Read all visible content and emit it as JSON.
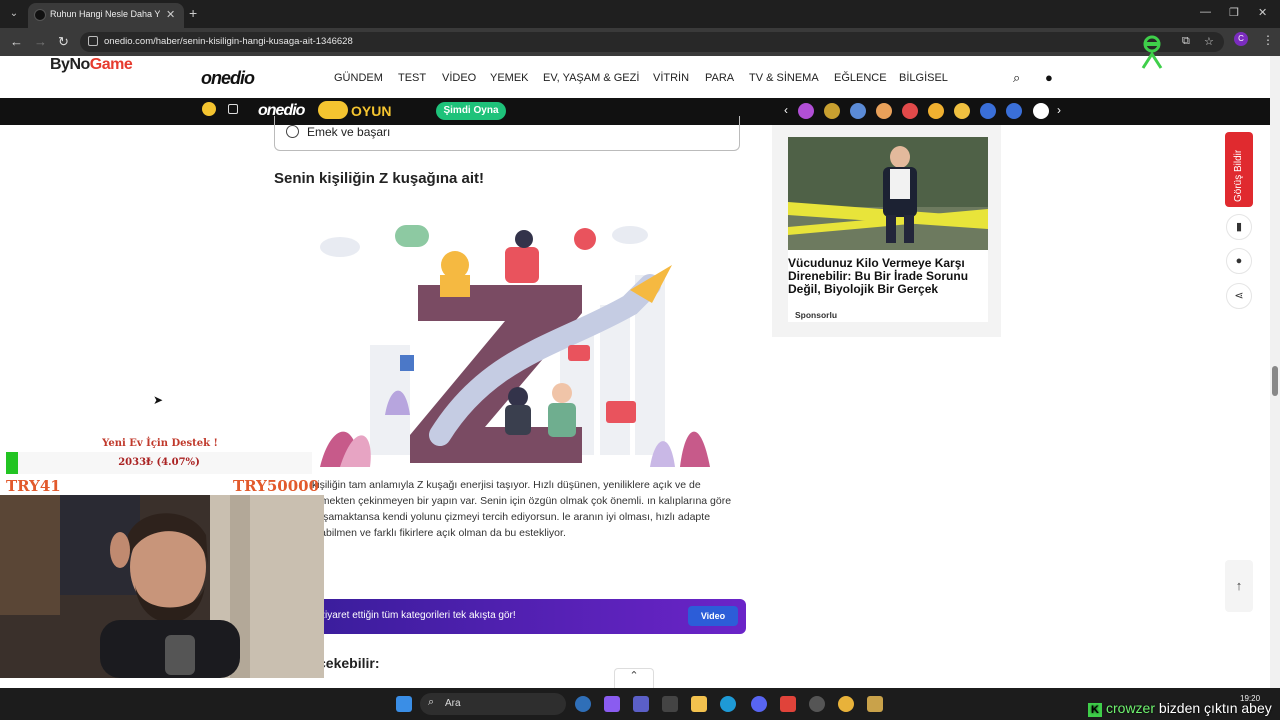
{
  "browser": {
    "tab_title": "Ruhun Hangi Nesle Daha Yakın?",
    "url": "onedio.com/haber/senin-kisiligin-hangi-kusaga-ait-1346628",
    "profile_initial": "C"
  },
  "site": {
    "brand": "onedio",
    "overlay_brand_main": "ByNo",
    "overlay_brand_accent": "Game",
    "nav": [
      "GÜNDEM",
      "TEST",
      "VİDEO",
      "YEMEK",
      "EV, YAŞAM & GEZİ",
      "VİTRİN",
      "PARA",
      "TV & SİNEMA",
      "EĞLENCE",
      "BİLGİSEL"
    ]
  },
  "gamebar": {
    "brand": "onedio",
    "label": "OYUN",
    "play_label": "Şimdi Oyna",
    "emoji_colors": [
      "#b14fd6",
      "#c8a030",
      "#5b8bd6",
      "#e9a15a",
      "#e24a4a",
      "#f0b030",
      "#f0c040",
      "#3a6fd8",
      "#3a6fd8",
      "#ffffff"
    ]
  },
  "quiz": {
    "option_label": "Emek ve başarı",
    "result_title": "Senin kişiliğin Z kuşağına ait!",
    "result_text": "kişiliğin tam anlamıyla Z kuşağı enerjisi taşıyor. Hızlı düşünen, yeniliklere açık ve de etmekten çekinmeyen bir yapın var. Senin için özgün olmak çok önemli. ın kalıplarına göre yaşamaktansa kendi yolunu çizmeyi tercih ediyorsun. le aranın iyi olması, hızlı adapte olabilmen ve farklı fikirlere açık olman da bu estekliyor.",
    "promo_text": "ziyaret ettiğin tüm kategorileri tek akışta gör!",
    "promo_button": "Video",
    "next_heading": "cekebilir:"
  },
  "sidebar_card": {
    "title": "Vücudunuz Kilo Vermeye Karşı Direnebilir: Bu Bir İrade Sorunu Değil, Biyolojik Bir Gerçek",
    "sponsor": "Sponsorlu"
  },
  "rail": {
    "feedback_label": "Görüş Bildir"
  },
  "stream": {
    "donate_title": "Yeni Ev İçin Destek !",
    "donate_value": "2033₺ (4.07%)",
    "donate_progress": 0.0407,
    "goal_left": "TRY41",
    "goal_right": "TRY50000"
  },
  "taskbar": {
    "search_label": "Ara",
    "clock": "19:20",
    "ticker_name": "crowzer",
    "ticker_text": "bizden çıktın abey"
  },
  "colors": {
    "accent_red": "#e02a2f",
    "promo_purple": "#5a22b8",
    "play_green": "#1ec27a",
    "oyun_yellow": "#f4c430"
  }
}
